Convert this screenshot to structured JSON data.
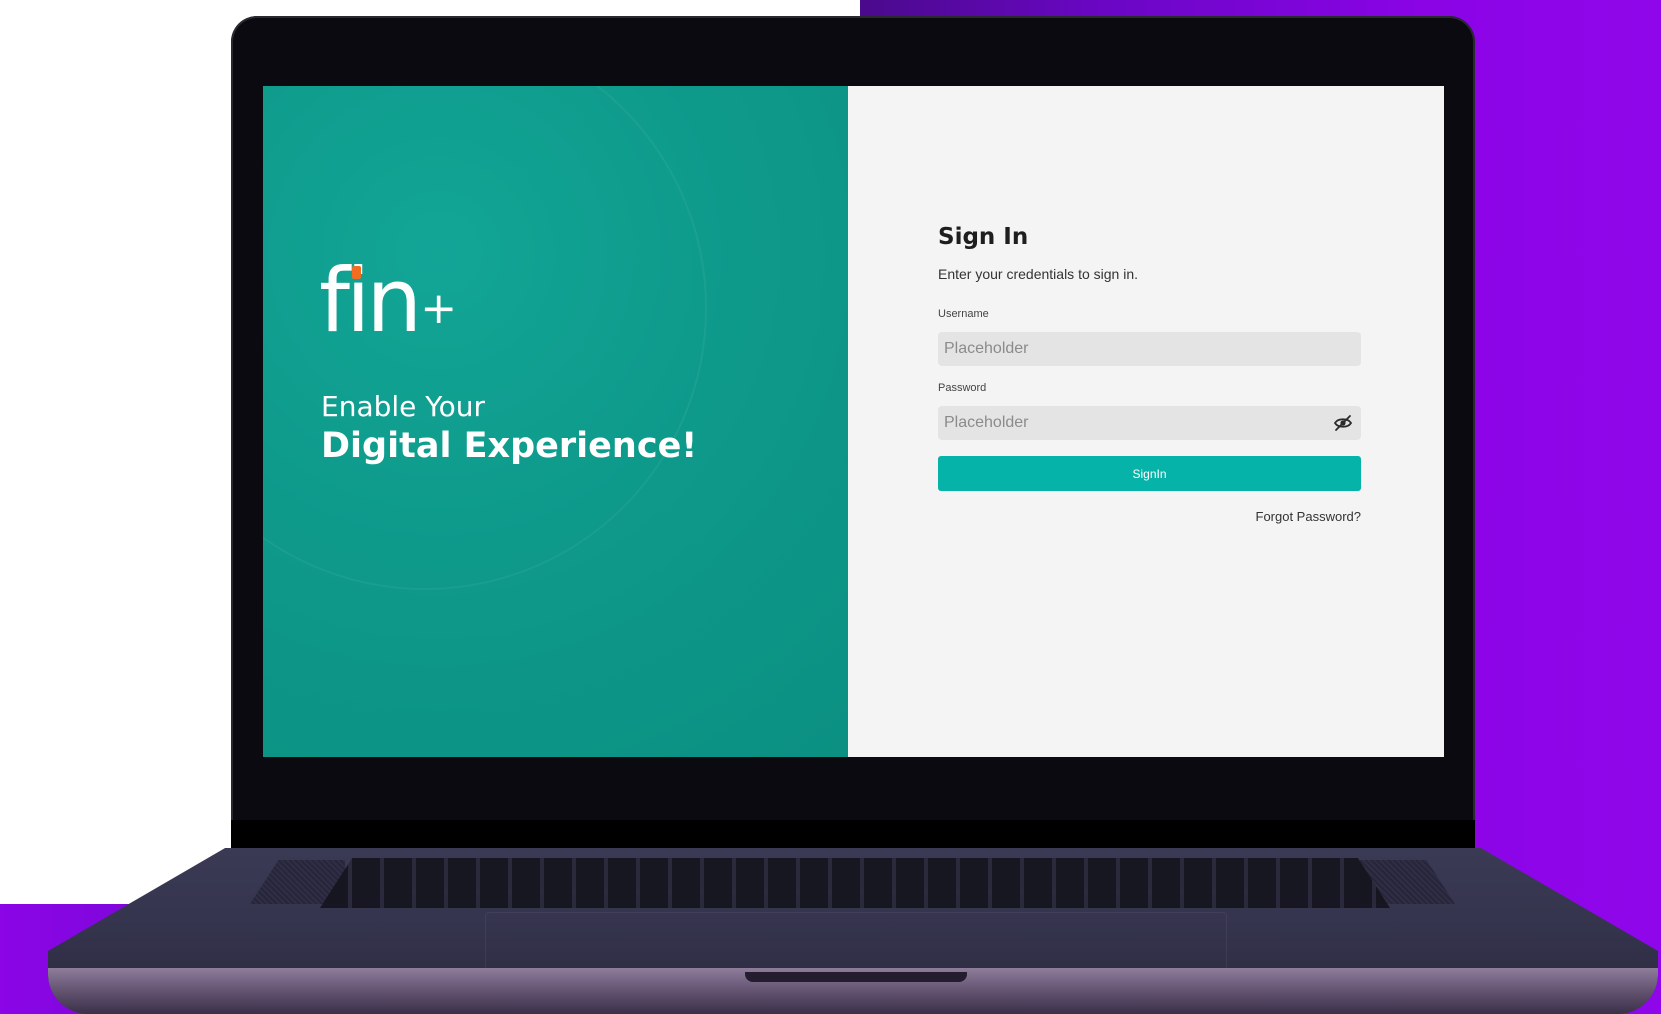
{
  "brand": {
    "logo_text": "fin",
    "logo_plus": "+",
    "tagline_line1": "Enable Your",
    "tagline_line2": "Digital Experience!"
  },
  "signin": {
    "title": "Sign In",
    "subtitle": "Enter your credentials to sign in.",
    "username": {
      "label": "Username",
      "value": "",
      "placeholder": "Placeholder"
    },
    "password": {
      "label": "Password",
      "value": "",
      "placeholder": "Placeholder",
      "toggle_icon": "eye-off-icon"
    },
    "button_label": "SignIn",
    "forgot_password": "Forgot Password?"
  },
  "colors": {
    "brand_teal": "#0e9a8b",
    "button_teal": "#06b3a8",
    "logo_accent": "#f36c21",
    "panel_bg": "#f4f4f4",
    "input_bg": "#e4e4e4",
    "background_purple": "#8a04e6"
  }
}
